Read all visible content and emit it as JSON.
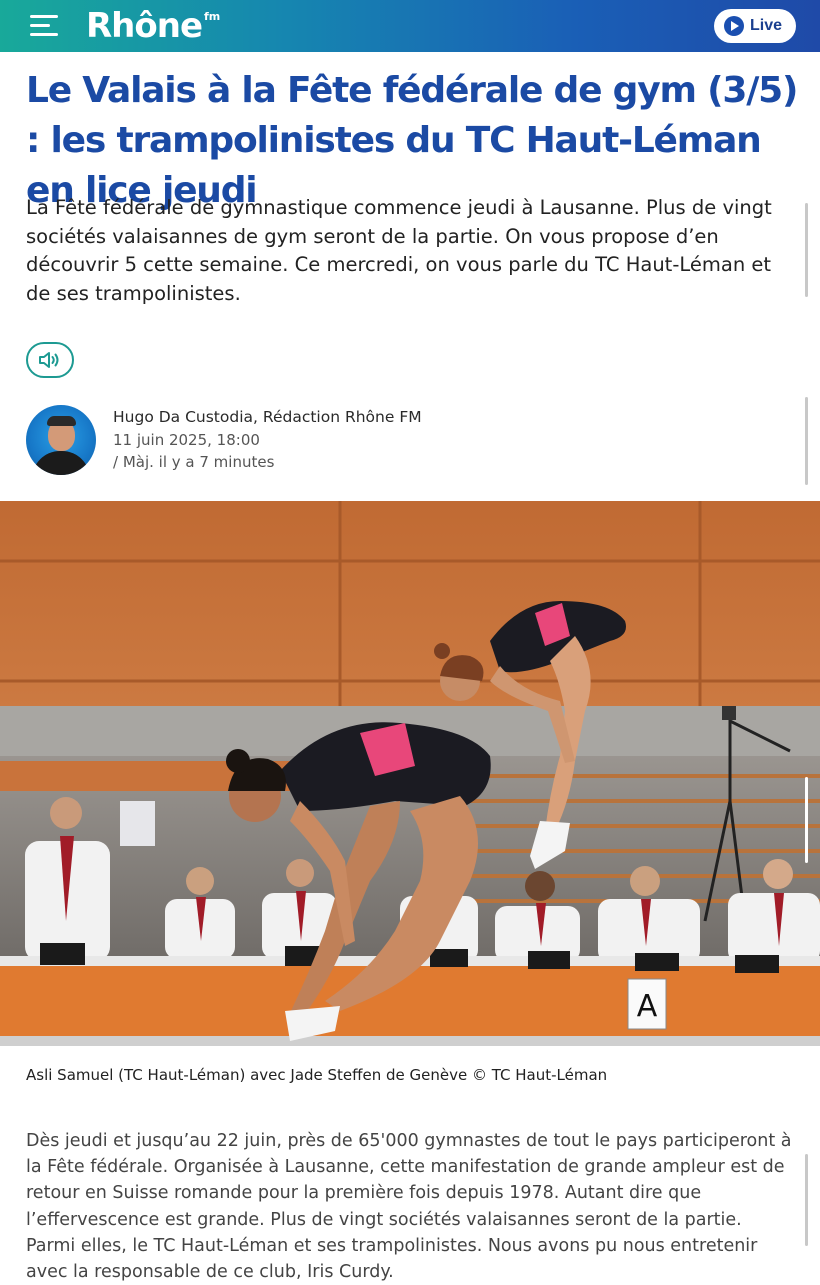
{
  "header": {
    "logo_text": "Rhône",
    "logo_suffix": "fm",
    "live_label": "Live",
    "menu_icon": "hamburger-menu-icon",
    "live_icon": "play-icon"
  },
  "article": {
    "title": "Le Valais à la Fête fédérale de gym (3/5) : les trampolinistes du TC Haut-Léman en lice jeudi",
    "lead": "La Fête fédérale de gymnastique commence jeudi à Lausanne. Plus de vingt sociétés valaisannes de gym seront de la partie. On vous propose d’en découvrir 5 cette semaine. Ce mercredi, on vous parle du TC Haut-Léman et de ses trampolinistes.",
    "audio_icon": "speaker-icon",
    "author": {
      "name": "Hugo Da Custodia, Rédaction Rhône FM",
      "date": "11 juin 2025, 18:00",
      "updated": "/ Màj. il y a 7 minutes"
    },
    "photo": {
      "judge_sign": "A"
    },
    "caption": "Asli Samuel (TC Haut-Léman) avec Jade Steffen de Genève © TC Haut-Léman",
    "body": "Dès jeudi et jusqu’au 22 juin, près de 65'000 gymnastes de tout le pays participeront à la Fête fédérale. Organisée à Lausanne, cette manifestation de grande ampleur est de retour en Suisse romande pour la première fois depuis 1978. Autant dire que l’effervescence est grande. Plus de vingt sociétés valaisannes seront de la partie. Parmi elles, le TC Haut-Léman et ses trampolinistes. Nous avons pu nous entretenir avec la responsable de ce club, Iris Curdy."
  },
  "colors": {
    "title": "#1b4aa4",
    "accent": "#1d9a92",
    "header_start": "#18a99a",
    "header_end": "#1f4aa8"
  }
}
